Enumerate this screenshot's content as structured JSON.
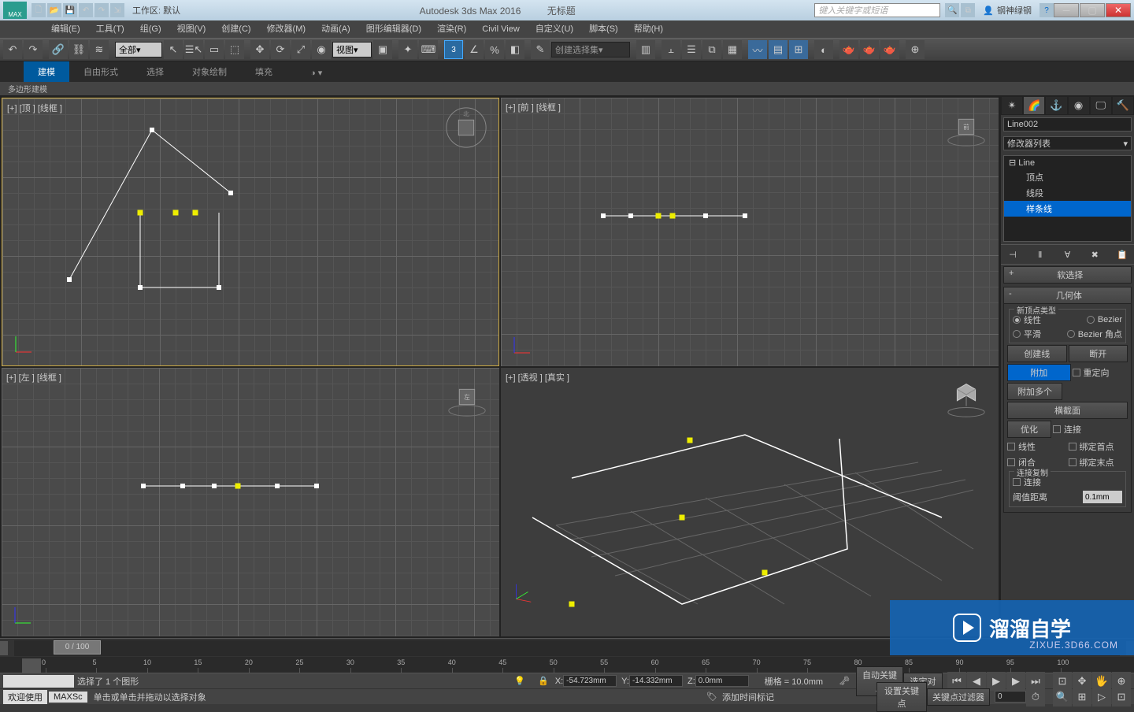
{
  "titlebar": {
    "logo_text": "MAX",
    "workspace": "工作区: 默认",
    "app_title": "Autodesk 3ds Max 2016",
    "doc_title": "无标题",
    "search_placeholder": "键入关键字或短语",
    "user_name": "钢神绿钢"
  },
  "menubar": [
    "编辑(E)",
    "工具(T)",
    "组(G)",
    "视图(V)",
    "创建(C)",
    "修改器(M)",
    "动画(A)",
    "图形编辑器(D)",
    "渲染(R)",
    "Civil View",
    "自定义(U)",
    "脚本(S)",
    "帮助(H)"
  ],
  "toolbar": {
    "selection_filter": "全部",
    "ref_coord": "视图",
    "spinner_val": "3",
    "named_sel": "创建选择集"
  },
  "ribbon": {
    "tabs": [
      "建模",
      "自由形式",
      "选择",
      "对象绘制",
      "填充"
    ],
    "sub": "多边形建模"
  },
  "viewports": {
    "top": "[+] [顶 ] [线框 ]",
    "front": "[+] [前 ] [线框 ]",
    "left": "[+] [左 ] [线框 ]",
    "persp": "[+] [透视 ] [真实 ]",
    "cube_front": "前"
  },
  "command_panel": {
    "object_name": "Line002",
    "modifier_list": "修改器列表",
    "stack": {
      "parent": "Line",
      "children": [
        "顶点",
        "线段",
        "样条线"
      ]
    },
    "rollouts": {
      "soft_sel": "软选择",
      "geometry": "几何体"
    },
    "new_vertex_type": {
      "title": "新顶点类型",
      "linear": "线性",
      "bezier": "Bezier",
      "smooth": "平滑",
      "bezier_corner": "Bezier 角点"
    },
    "buttons": {
      "create_line": "创建线",
      "break": "断开",
      "attach": "附加",
      "attach_mult": "附加多个",
      "reorient": "重定向",
      "cross_section": "横截面",
      "optimize": "优化",
      "connect": "连接",
      "linear": "线性",
      "bind_first": "绑定首点",
      "closed": "闭合",
      "bind_last": "绑定末点"
    },
    "connect_copy": {
      "title": "连接复制",
      "connect": "连接",
      "thresh_label": "阈值距离",
      "thresh_val": "0.1mm"
    }
  },
  "timeline": {
    "slider": "0 / 100",
    "ticks": [
      "0",
      "5",
      "10",
      "15",
      "20",
      "25",
      "30",
      "35",
      "40",
      "45",
      "50",
      "55",
      "60",
      "65",
      "70",
      "75",
      "80",
      "85",
      "90",
      "95",
      "100"
    ]
  },
  "status": {
    "selected": "选择了 1 个图形",
    "x_label": "X:",
    "x_val": "-54.723mm",
    "y_label": "Y:",
    "y_val": "-14.332mm",
    "z_label": "Z:",
    "z_val": "0.0mm",
    "grid": "栅格 = 10.0mm",
    "auto_key": "自动关键点",
    "sel_pair": "选定对",
    "set_key": "设置关键点",
    "key_filter": "关键点过滤器",
    "add_time_tag": "添加时间标记"
  },
  "status2": {
    "welcome": "欢迎使用",
    "script": "MAXSc",
    "hint": "单击或单击并拖动以选择对象"
  },
  "watermark": {
    "title": "溜溜自学",
    "sub": "ZIXUE.3D66.COM"
  }
}
